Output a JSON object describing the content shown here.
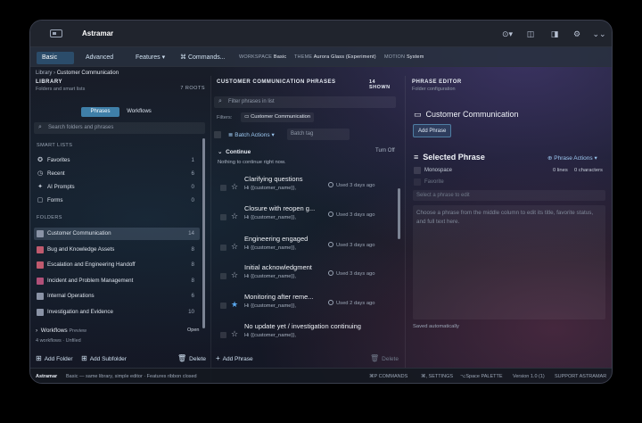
{
  "app": {
    "title": "Astramar"
  },
  "ribbon": {
    "modes": [
      "Basic",
      "Advanced"
    ],
    "features": "Features",
    "commands": "Commands...",
    "workspace_label": "WORKSPACE",
    "workspace_value": "Basic",
    "theme_label": "THEME",
    "theme_value": "Aurora Glass (Experiment)",
    "motion_label": "MOTION",
    "motion_value": "System"
  },
  "breadcrumb": {
    "root": "Library",
    "current": "Customer Communication"
  },
  "library": {
    "title": "LIBRARY",
    "subtitle": "Folders and smart lists",
    "roots": "7 ROOTS",
    "tabs": [
      "Phrases",
      "Workflows"
    ],
    "search_placeholder": "Search folders and phrases",
    "smart_lists_label": "SMART LISTS",
    "smart_lists": [
      {
        "label": "Favorites",
        "count": "1",
        "icon": "star-icon"
      },
      {
        "label": "Recent",
        "count": "6",
        "icon": "clock-icon"
      },
      {
        "label": "AI Prompts",
        "count": "0",
        "icon": "sparkle-icon"
      },
      {
        "label": "Forms",
        "count": "0",
        "icon": "form-icon"
      }
    ],
    "folders_label": "FOLDERS",
    "folders": [
      {
        "label": "Customer Communication",
        "count": "14",
        "color": "#8a93a6"
      },
      {
        "label": "Bug and Knowledge Assets",
        "count": "8",
        "color": "#c05a6e"
      },
      {
        "label": "Escalation and Engineering Handoff",
        "count": "8",
        "color": "#c05a6e"
      },
      {
        "label": "Incident and Problem Management",
        "count": "8",
        "color": "#b05078"
      },
      {
        "label": "Internal Operations",
        "count": "6",
        "color": "#8a93a6"
      },
      {
        "label": "Investigation and Evidence",
        "count": "10",
        "color": "#8a93a6"
      }
    ],
    "workflows_label": "Workflows",
    "workflows_badge": "Preview",
    "workflows_open": "Open",
    "workflows_summary": "4 workflows · Unfiled",
    "add_folder": "Add Folder",
    "add_subfolder": "Add Subfolder",
    "delete": "Delete"
  },
  "phrases": {
    "title": "CUSTOMER COMMUNICATION PHRASES",
    "shown": "14 SHOWN",
    "filter_placeholder": "Filter phrases in list",
    "filters_label": "Filters:",
    "filter_chip": "Customer Communication",
    "batch_actions": "Batch Actions",
    "batch_tag_placeholder": "Batch tag",
    "continue_label": "Continue",
    "turn_off": "Turn Off",
    "continue_empty": "Nothing to continue right now.",
    "items": [
      {
        "title": "Clarifying questions",
        "desc": "Hi {{customer_name}},",
        "used": "Used 3 days ago",
        "fav": false
      },
      {
        "title": "Closure with reopen g...",
        "desc": "Hi {{customer_name}},",
        "used": "Used 3 days ago",
        "fav": false
      },
      {
        "title": "Engineering engaged",
        "desc": "Hi {{customer_name}},",
        "used": "Used 3 days ago",
        "fav": false
      },
      {
        "title": "Initial acknowledgment",
        "desc": "Hi {{customer_name}},",
        "used": "Used 3 days ago",
        "fav": false
      },
      {
        "title": "Monitoring after reme...",
        "desc": "Hi {{customer_name}},",
        "used": "Used 2 days ago",
        "fav": true
      },
      {
        "title": "No update yet / investigation continuing",
        "desc": "Hi {{customer_name}},",
        "used": "",
        "fav": false
      }
    ],
    "add_phrase": "Add Phrase",
    "delete": "Delete"
  },
  "editor": {
    "title": "PHRASE EDITOR",
    "subtitle": "Folder configuration",
    "folder_name": "Customer Communication",
    "add_phrase": "Add Phrase",
    "selected_title": "Selected Phrase",
    "phrase_actions": "Phrase Actions",
    "monospace": "Monospace",
    "lines": "0 lines",
    "characters": "0 characters",
    "favorite": "Favorite",
    "title_placeholder": "Select a phrase to edit",
    "body_placeholder": "Choose a phrase from the middle column to edit its title, favorite status, and full text here.",
    "saved": "Saved automatically"
  },
  "status": {
    "app": "Astramar",
    "mode": "Basic — same library, simple editor · Features ribbon closed",
    "commands": "⌘P COMMANDS",
    "settings": "⌘, SETTINGS",
    "palette": "⌥Space PALETTE",
    "version": "Version 1.0 (1)",
    "support": "SUPPORT ASTRAMAR"
  }
}
